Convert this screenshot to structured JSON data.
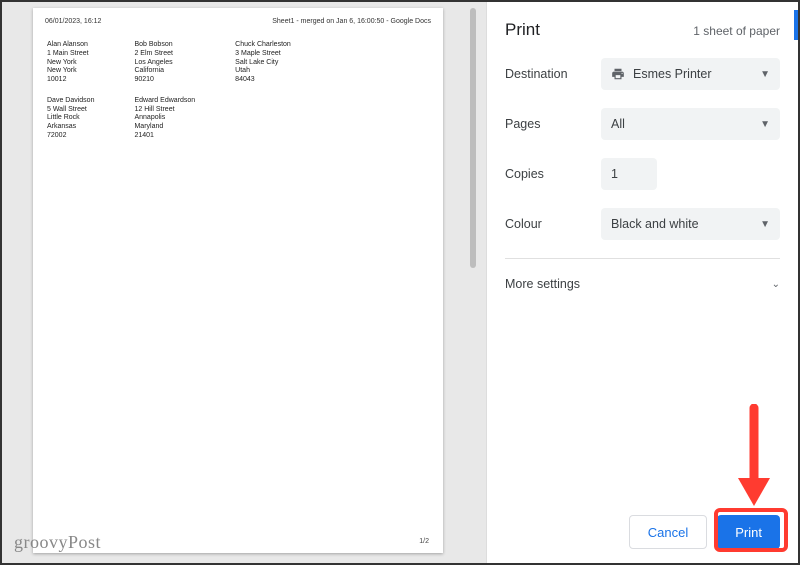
{
  "preview": {
    "timestamp": "06/01/2023, 16:12",
    "doc_title": "Sheet1 - merged on Jan 6, 16:00:50 - Google Docs",
    "page_indicator": "1/2",
    "columns": [
      [
        {
          "lines": [
            "Alan Alanson",
            "1 Main Street",
            "New York",
            "New York",
            "10012"
          ]
        },
        {
          "lines": [
            "Dave Davidson",
            "5 Wall Street",
            "Little Rock",
            "Arkansas",
            "72002"
          ]
        }
      ],
      [
        {
          "lines": [
            "Bob Bobson",
            "2 Elm Street",
            "Los Angeles",
            "California",
            "90210"
          ]
        },
        {
          "lines": [
            "Edward Edwardson",
            "12 Hill Street",
            "Annapolis",
            "Maryland",
            "21401"
          ]
        }
      ],
      [
        {
          "lines": [
            "Chuck Charleston",
            "3 Maple Street",
            "Salt Lake City",
            "Utah",
            "84043"
          ]
        }
      ]
    ]
  },
  "panel": {
    "title": "Print",
    "sheet_summary": "1 sheet of paper",
    "destination_label": "Destination",
    "destination_value": "Esmes Printer",
    "pages_label": "Pages",
    "pages_value": "All",
    "copies_label": "Copies",
    "copies_value": "1",
    "colour_label": "Colour",
    "colour_value": "Black and white",
    "more_settings": "More settings",
    "cancel": "Cancel",
    "print": "Print"
  },
  "watermark": "groovyPost"
}
